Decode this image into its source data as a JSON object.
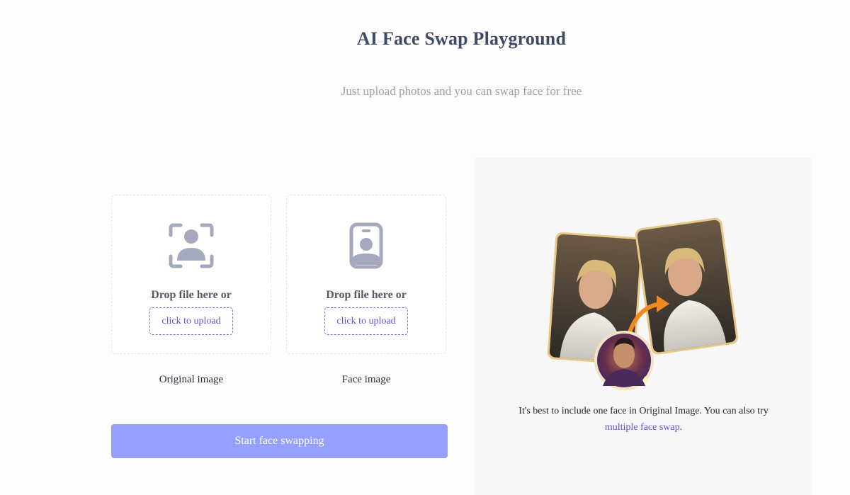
{
  "header": {
    "title": "AI Face Swap Playground",
    "subtitle": "Just upload photos and you can swap face for free"
  },
  "upload": {
    "original": {
      "drop_text": "Drop file here or",
      "button_label": "click to upload",
      "caption": "Original image",
      "icon": "face-scan-icon"
    },
    "face": {
      "drop_text": "Drop file here or",
      "button_label": "click to upload",
      "caption": "Face image",
      "icon": "portrait-card-icon"
    }
  },
  "actions": {
    "start_label": "Start face swapping"
  },
  "panel": {
    "hint_text": "It's best to include one face in Original Image. You can also try",
    "hint_link": "multiple face swap",
    "hint_end": "."
  },
  "colors": {
    "accent": "#6a4fd0",
    "button": "#94a0fc",
    "icon": "#a4a9bd"
  }
}
